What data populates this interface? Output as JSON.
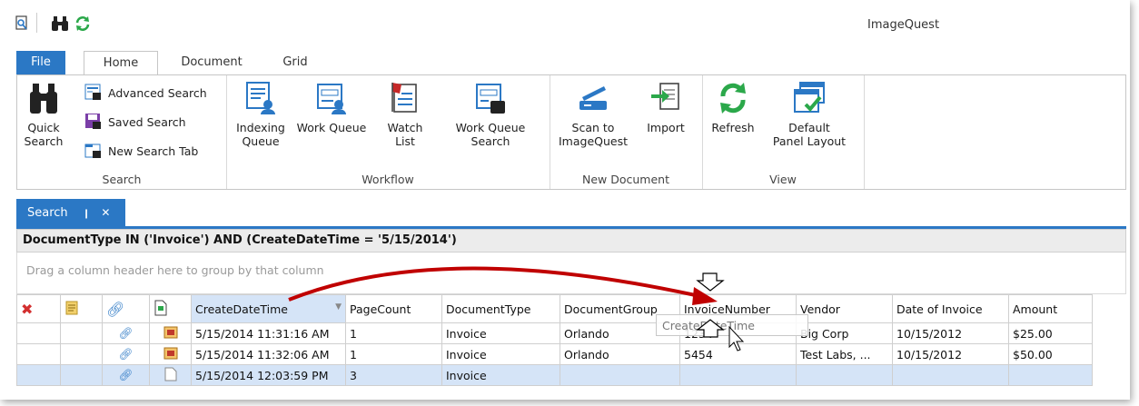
{
  "app": {
    "title": "ImageQuest"
  },
  "ribbon_tabs": [
    {
      "label": "File"
    },
    {
      "label": "Home"
    },
    {
      "label": "Document"
    },
    {
      "label": "Grid"
    }
  ],
  "groups": {
    "search": {
      "label": "Search",
      "quick_search": "Quick\nSearch",
      "advanced_search": "Advanced Search",
      "saved_search": "Saved Search",
      "new_search_tab": "New Search Tab"
    },
    "workflow": {
      "label": "Workflow",
      "indexing_queue": "Indexing\nQueue",
      "work_queue": "Work Queue",
      "watch_list": "Watch\nList",
      "work_queue_search": "Work Queue\nSearch"
    },
    "new_document": {
      "label": "New Document",
      "scan": "Scan to\nImageQuest",
      "import": "Import"
    },
    "view": {
      "label": "View",
      "refresh": "Refresh",
      "default_layout": "Default\nPanel Layout"
    }
  },
  "doc_tab": {
    "label": "Search",
    "pin": "❙",
    "close": "✕"
  },
  "query": "DocumentType IN ('Invoice') AND (CreateDateTime = '5/15/2014')",
  "group_panel_hint": "Drag a column header here to group by that column",
  "columns": [
    "CreateDateTime",
    "PageCount",
    "DocumentType",
    "DocumentGroup",
    "InvoiceNumber",
    "Vendor",
    "Date of Invoice",
    "Amount"
  ],
  "rows": [
    {
      "create": "5/15/2014 11:31:16 AM",
      "pages": "1",
      "type": "Invoice",
      "group": "Orlando",
      "invoice": "1234",
      "vendor": "Big Corp",
      "date": "10/15/2012",
      "amount": "$25.00"
    },
    {
      "create": "5/15/2014 11:32:06 AM",
      "pages": "1",
      "type": "Invoice",
      "group": "Orlando",
      "invoice": "5454",
      "vendor": "Test Labs, ...",
      "date": "10/15/2012",
      "amount": "$50.00"
    },
    {
      "create": "5/15/2014 12:03:59 PM",
      "pages": "3",
      "type": "Invoice",
      "group": "",
      "invoice": "",
      "vendor": "",
      "date": "",
      "amount": ""
    }
  ],
  "drag_ghost": "CreateDateTime",
  "colors": {
    "accent": "#2b78c5",
    "selected_row": "#d5e4f7",
    "arrow": "#c00000"
  }
}
